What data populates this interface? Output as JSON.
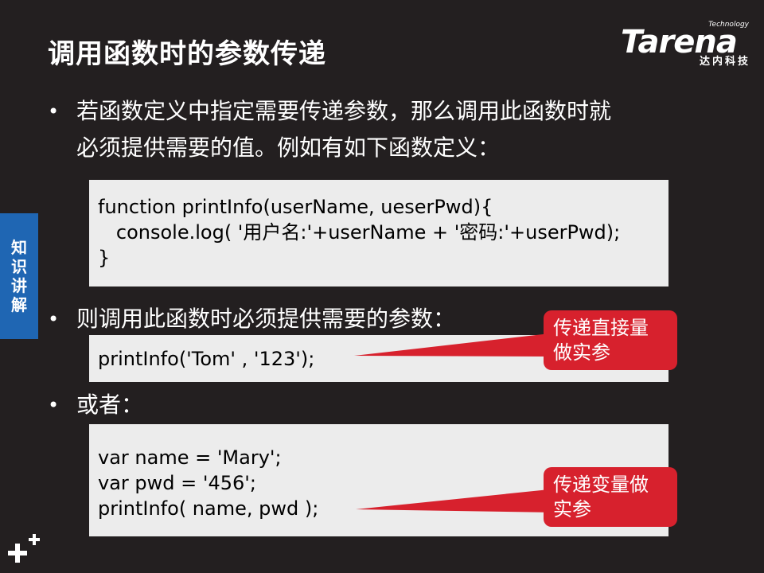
{
  "title": "调用函数时的参数传递",
  "logo": {
    "tech": "Technology",
    "word": "Tarena",
    "sub": "达内科技"
  },
  "side_tab": [
    "知",
    "识",
    "讲",
    "解"
  ],
  "bullets": {
    "b1_line1": "若函数定义中指定需要传递参数，那么调用此函数时就",
    "b1_line2": "必须提供需要的值。例如有如下函数定义：",
    "b2": "则调用此函数时必须提供需要的参数：",
    "b3": "或者："
  },
  "bullet_glyph": "•",
  "code1": [
    "function printInfo(userName, ueserPwd){",
    "   console.log( '用户名:'+userName + '密码:'+userPwd);",
    "}"
  ],
  "code2": [
    "printInfo('Tom' , '123');"
  ],
  "code3": [
    "var name = 'Mary';",
    "var pwd = '456';",
    "printInfo( name, pwd );"
  ],
  "callouts": {
    "c1_line1": "传递直接量",
    "c1_line2": "做实参",
    "c2_line1": "传递变量做",
    "c2_line2": "实参"
  },
  "colors": {
    "background": "#231f20",
    "code_bg": "#ececec",
    "callout": "#d7212d",
    "side_tab": "#1f66b3"
  }
}
